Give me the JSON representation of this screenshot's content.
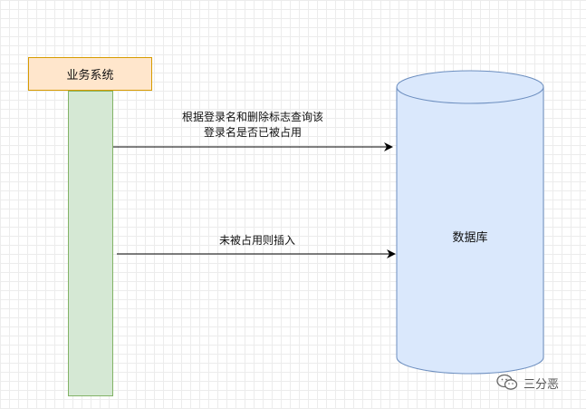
{
  "system": {
    "label": "业务系统"
  },
  "database": {
    "label": "数据库"
  },
  "messages": [
    {
      "line1": "根据登录名和删除标志查询该",
      "line2": "登录名是否已被占用"
    },
    {
      "line1": "未被占用则插入"
    }
  ],
  "watermark": {
    "text": "三分恶",
    "icon": "wechat-icon"
  },
  "colors": {
    "system_fill": "#ffe6cc",
    "system_stroke": "#d79b00",
    "lifeline_fill": "#d5e8d4",
    "lifeline_stroke": "#82b366",
    "database_fill": "#dae8fc",
    "database_stroke": "#6c8ebf"
  }
}
